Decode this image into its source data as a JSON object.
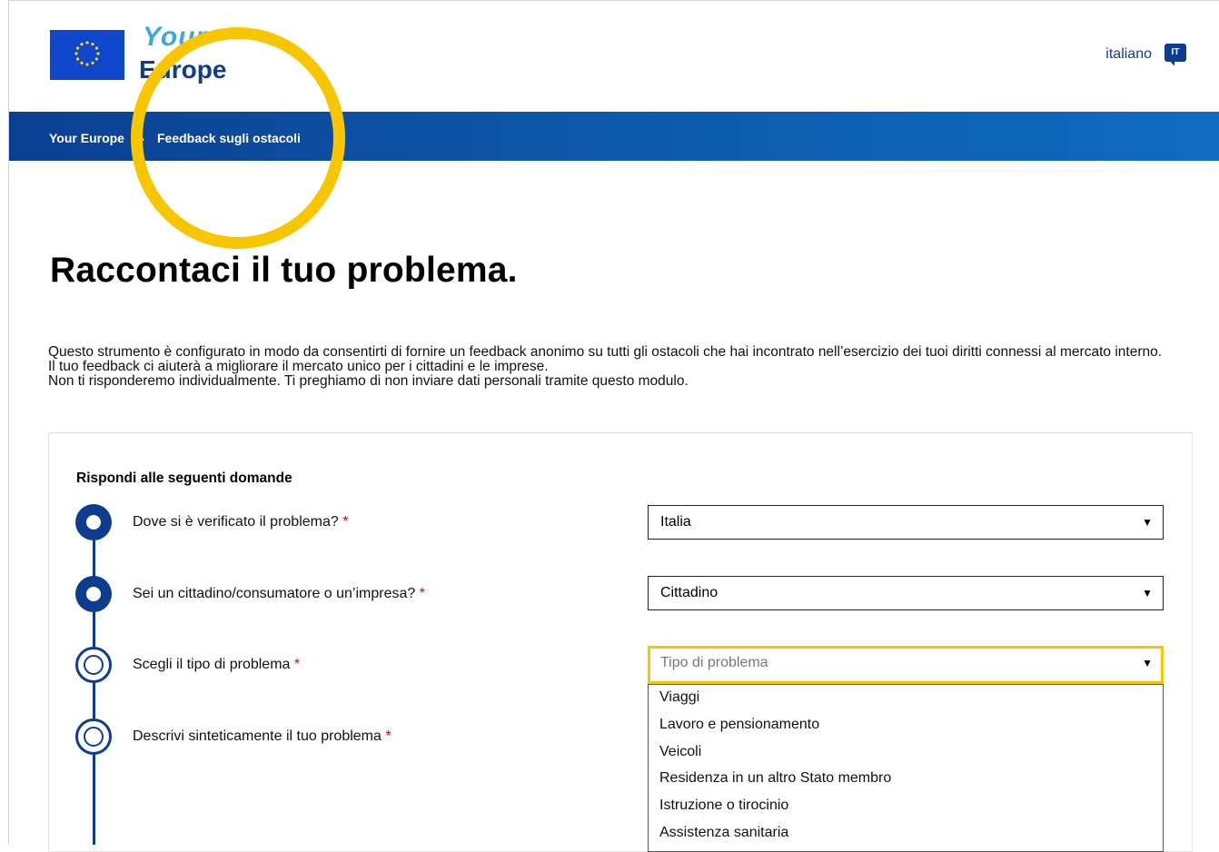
{
  "header": {
    "logo_line1": "Your",
    "logo_line2": "Europe",
    "language": "italiano",
    "language_code": "IT"
  },
  "breadcrumb": {
    "items": [
      "Your Europe",
      "Feedback sugli ostacoli"
    ],
    "separator": "›"
  },
  "page": {
    "title": "Raccontaci il tuo problema.",
    "intro": [
      "Questo strumento è configurato in modo da consentirti di fornire un feedback anonimo su tutti gli ostacoli che hai incontrato nell’esercizio dei tuoi diritti connessi al mercato interno.",
      "Il tuo feedback ci aiuterà a migliorare il mercato unico per i cittadini e le imprese.",
      "Non ti risponderemo individualmente. Ti preghiamo di non inviare dati personali tramite questo modulo."
    ]
  },
  "form": {
    "heading": "Rispondi alle seguenti domande",
    "required_mark": "*",
    "questions": [
      {
        "label": "Dove si è verificato il problema?",
        "value": "Italia",
        "state": "done"
      },
      {
        "label": "Sei un cittadino/consumatore o un’impresa?",
        "value": "Cittadino",
        "state": "done"
      },
      {
        "label": "Scegli il tipo di problema",
        "placeholder": "Tipo di problema",
        "state": "current"
      },
      {
        "label": "Descrivi sinteticamente il tuo problema",
        "state": "todo"
      }
    ],
    "dropdown_arrow": "▼",
    "problem_type_options": [
      "Viaggi",
      "Lavoro e pensionamento",
      "Veicoli",
      "Residenza in un altro Stato membro",
      "Istruzione o tirocinio",
      "Assistenza sanitaria"
    ]
  },
  "colors": {
    "brand_blue": "#0e3d8f",
    "highlight_yellow": "#f7c600",
    "required_red": "#d0021b"
  }
}
